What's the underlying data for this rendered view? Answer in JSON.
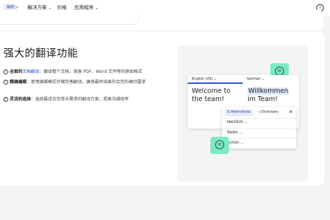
{
  "nav": {
    "badge": "新的",
    "items": [
      {
        "label": "解决方案"
      },
      {
        "label": "价格"
      },
      {
        "label": "应用程序"
      }
    ],
    "help_label": "?"
  },
  "section": {
    "title": "强大的翻译功能",
    "features": [
      {
        "bold": "全面的",
        "link": "文档翻译",
        "text": "：翻译整个文档，保留 PDF、Word 文件等的原始格式"
      },
      {
        "bold": "精确编辑",
        "link": "",
        "text": "：使用编辑模式仔细完善翻译，确保最终结果符合您的确切要求"
      },
      {
        "bold": "灵活的选择",
        "link": "",
        "text": "：选择最适合您受众需求的翻译方案，提高沟通效率"
      }
    ]
  },
  "translator": {
    "source_lang": "English (US)",
    "target_lang": "German",
    "source_text": "Welcome to the team!",
    "target_word1": "Willkommen",
    "target_rest": " im Team!",
    "tabs": {
      "alternatives": "Alternatives",
      "dictionary": "Dictionary"
    },
    "alternatives": [
      "Herzlich ...",
      "Seien ...",
      "Schön ..."
    ]
  },
  "colors": {
    "accent": "#1c50c8",
    "mint": "#7de8c6",
    "badge_bg": "#e1e9fa"
  }
}
